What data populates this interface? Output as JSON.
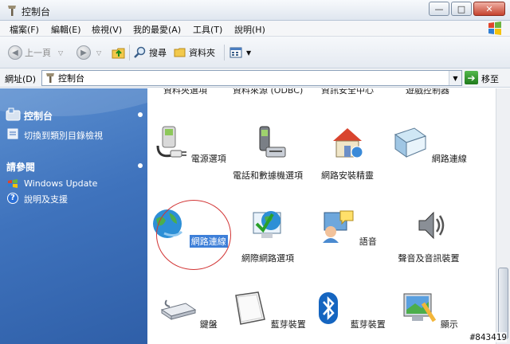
{
  "window": {
    "title": "控制台"
  },
  "menu": [
    "檔案(F)",
    "編輯(E)",
    "檢視(V)",
    "我的最愛(A)",
    "工具(T)",
    "說明(H)"
  ],
  "toolbar": {
    "back": "上一頁",
    "search": "搜尋",
    "folders": "資料夾"
  },
  "address": {
    "label": "網址(D)",
    "value": "控制台",
    "go": "移至"
  },
  "sidebar": {
    "panel_title": "控制台",
    "switch_view": "切換到類別目錄檢視",
    "see_also": "請參閱",
    "links": [
      "Windows Update",
      "說明及支援"
    ]
  },
  "top_row": [
    "資料夾選項",
    "資料來源 (ODBC)",
    "資訊安全中心",
    "遊戲控制器"
  ],
  "items": [
    {
      "label": "電源選項",
      "icon": "power-options-icon"
    },
    {
      "label": "電話和數據機選項",
      "icon": "phone-modem-icon"
    },
    {
      "label": "網路安裝精靈",
      "icon": "network-setup-wizard-icon"
    },
    {
      "label": "網路連線",
      "icon": "network-connection-icon"
    },
    {
      "label": "網路連線",
      "icon": "network-connections-globe-icon"
    },
    {
      "label": "網際網路選項",
      "icon": "internet-options-icon"
    },
    {
      "label": "語音",
      "icon": "speech-icon"
    },
    {
      "label": "聲音及音訊裝置",
      "icon": "sound-audio-icon"
    },
    {
      "label": "鍵盤",
      "icon": "keyboard-icon"
    },
    {
      "label": "藍芽裝置",
      "icon": "bluetooth-device-icon"
    },
    {
      "label": "藍芽裝置",
      "icon": "bluetooth-icon"
    },
    {
      "label": "顯示",
      "icon": "display-icon"
    }
  ],
  "watermark": "#843419",
  "colors": {
    "sidebar": "#3f73bd",
    "selection": "#3d7fd8",
    "highlight_circle": "#d23535"
  }
}
